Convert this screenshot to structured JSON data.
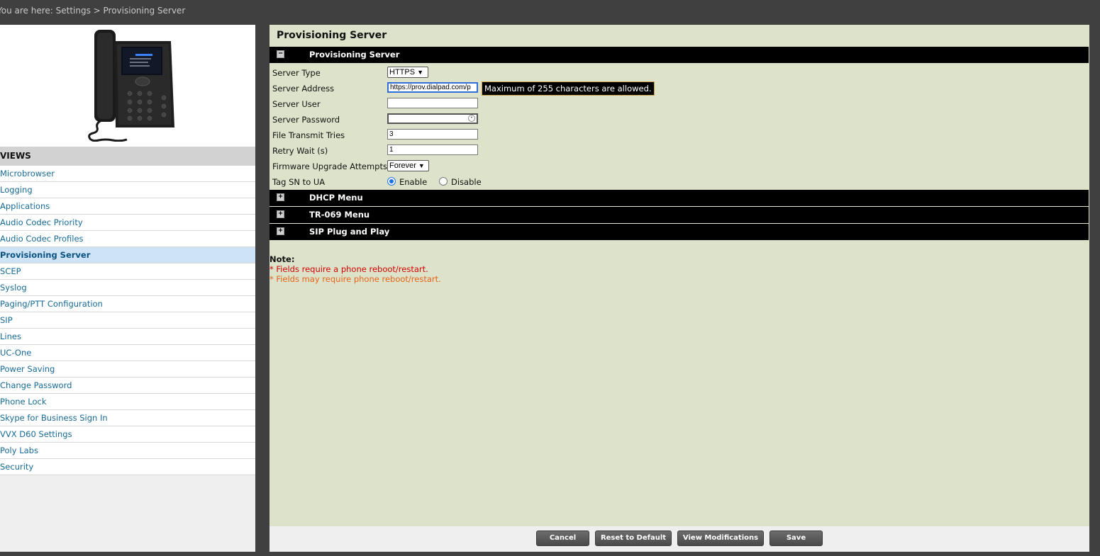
{
  "breadcrumb": "You are here: Settings > Provisioning Server",
  "sidebar": {
    "views_header": "VIEWS",
    "items": [
      {
        "label": "Microbrowser"
      },
      {
        "label": "Logging"
      },
      {
        "label": "Applications"
      },
      {
        "label": "Audio Codec Priority"
      },
      {
        "label": "Audio Codec Profiles"
      },
      {
        "label": "Provisioning Server",
        "active": true
      },
      {
        "label": "SCEP"
      },
      {
        "label": "Syslog"
      },
      {
        "label": "Paging/PTT Configuration"
      },
      {
        "label": "SIP"
      },
      {
        "label": "Lines"
      },
      {
        "label": "UC-One"
      },
      {
        "label": "Power Saving"
      },
      {
        "label": "Change Password"
      },
      {
        "label": "Phone Lock"
      },
      {
        "label": "Skype for Business Sign In"
      },
      {
        "label": "VVX D60 Settings"
      },
      {
        "label": "Poly Labs"
      },
      {
        "label": "Security"
      }
    ]
  },
  "main": {
    "page_title": "Provisioning Server",
    "sections": {
      "provisioning": {
        "title": "Provisioning Server",
        "toggle": "−"
      },
      "dhcp": {
        "title": "DHCP Menu",
        "toggle": "+"
      },
      "tr069": {
        "title": "TR-069 Menu",
        "toggle": "+"
      },
      "sip_pnp": {
        "title": "SIP Plug and Play",
        "toggle": "+"
      }
    },
    "form": {
      "server_type": {
        "label": "Server Type",
        "value": "HTTPS"
      },
      "server_address": {
        "label": "Server Address",
        "value": "https://prov.dialpad.com/p"
      },
      "server_user": {
        "label": "Server User",
        "value": ""
      },
      "server_password": {
        "label": "Server Password",
        "value": ""
      },
      "file_transmit_tries": {
        "label": "File Transmit Tries",
        "value": "3"
      },
      "retry_wait": {
        "label": "Retry Wait (s)",
        "value": "1"
      },
      "firmware_upgrade_attempts": {
        "label": "Firmware Upgrade Attempts",
        "value": "Forever"
      },
      "tag_sn_to_ua": {
        "label": "Tag SN to UA",
        "enable_label": "Enable",
        "disable_label": "Disable",
        "selected": "Enable"
      }
    },
    "tooltip": "Maximum of 255 characters are allowed.",
    "note": {
      "title": "Note:",
      "reboot": "* Fields require a phone reboot/restart.",
      "may_reboot": "* Fields may require phone reboot/restart."
    }
  },
  "footer": {
    "cancel": "Cancel",
    "reset": "Reset to Default",
    "view_mods": "View Modifications",
    "save": "Save"
  },
  "colors": {
    "panel_bg": "#dce3ca",
    "section_bar": "#000000",
    "nav_link": "#176b96",
    "required_red": "#d40000",
    "optional_orange": "#e8621a"
  }
}
